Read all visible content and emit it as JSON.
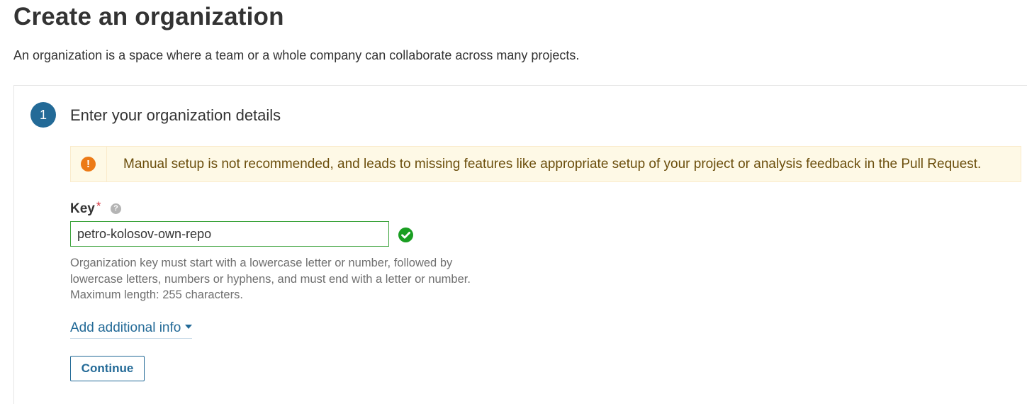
{
  "page": {
    "title": "Create an organization",
    "description": "An organization is a space where a team or a whole company can collaborate across many projects."
  },
  "step": {
    "number": "1",
    "title": "Enter your organization details"
  },
  "alert": {
    "icon": "exclamation-icon",
    "text": "Manual setup is not recommended, and leads to missing features like appropriate setup of your project or analysis feedback in the Pull Request."
  },
  "key_field": {
    "label": "Key",
    "required_mark": "*",
    "help_icon": "?",
    "value": "petro-kolosov-own-repo",
    "valid": true,
    "help_text": "Organization key must start with a lowercase letter or number, followed by lowercase letters, numbers or hyphens, and must end with a letter or number. Maximum length: 255 characters."
  },
  "additional_info_link": "Add additional info",
  "continue_label": "Continue",
  "colors": {
    "accent": "#236a97",
    "success": "#1a9e22",
    "warning": "#ec7a16",
    "alert_bg": "#fef9e6",
    "required": "#d4333f"
  }
}
